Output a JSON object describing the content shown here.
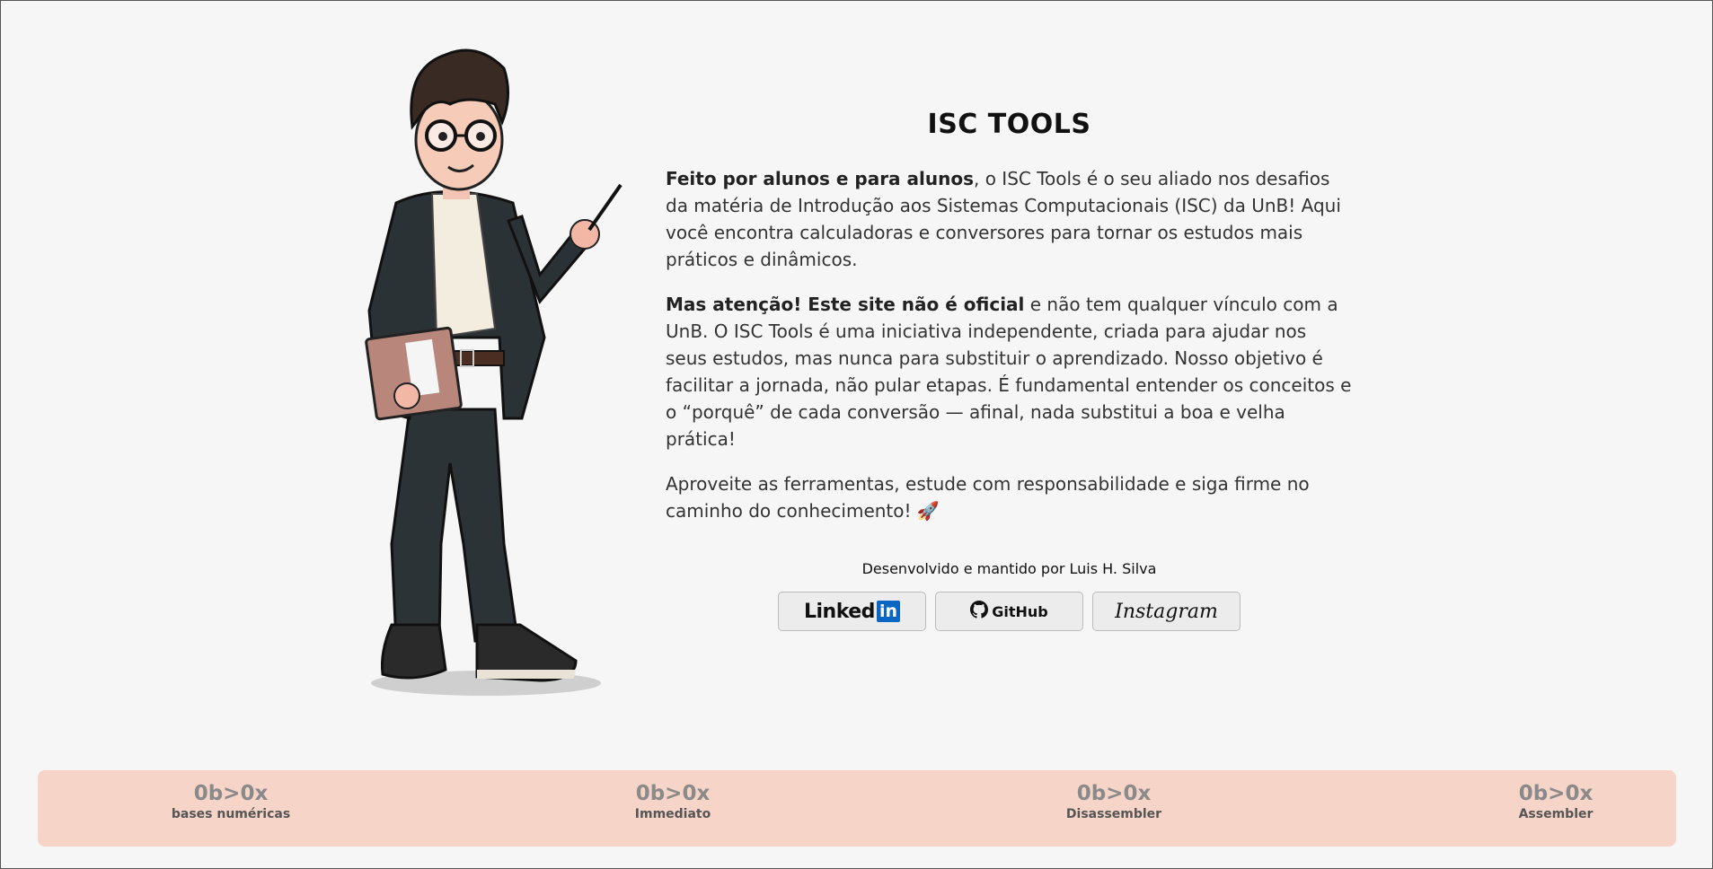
{
  "title": "ISC TOOLS",
  "intro": {
    "bold": "Feito por alunos e para alunos",
    "text": ", o ISC Tools é o seu aliado nos desafios da matéria de Introdução aos Sistemas Computacionais (ISC) da UnB! Aqui você encontra calculadoras e conversores para tornar os estudos mais práticos e dinâmicos."
  },
  "warning": {
    "bold": "Mas atenção! Este site não é oficial",
    "text": " e não tem qualquer vínculo com a UnB. O ISC Tools é uma iniciativa independente, criada para ajudar nos seus estudos, mas nunca para substituir o aprendizado. Nosso objetivo é facilitar a jornada, não pular etapas. É fundamental entender os conceitos e o “porquê” de cada conversão — afinal, nada substitui a boa e velha prática!"
  },
  "closing": "Aproveite as ferramentas, estude com responsabilidade e siga firme no caminho do conhecimento! 🚀",
  "credit": "Desenvolvido e mantido por Luis H. Silva",
  "socials": {
    "linkedin_text": "Linked",
    "linkedin_box": "in",
    "github": "GitHub",
    "instagram": "Instagram"
  },
  "footer": [
    {
      "logo": "0b>0x",
      "label": "bases numéricas"
    },
    {
      "logo": "0b>0x",
      "label": "Immediato"
    },
    {
      "logo": "0b>0x",
      "label": "Disassembler"
    },
    {
      "logo": "0b>0x",
      "label": "Assembler"
    }
  ],
  "colors": {
    "background": "#f6f6f6",
    "footer_bar": "#f7d4c8",
    "linkedin_blue": "#0a66c2"
  }
}
